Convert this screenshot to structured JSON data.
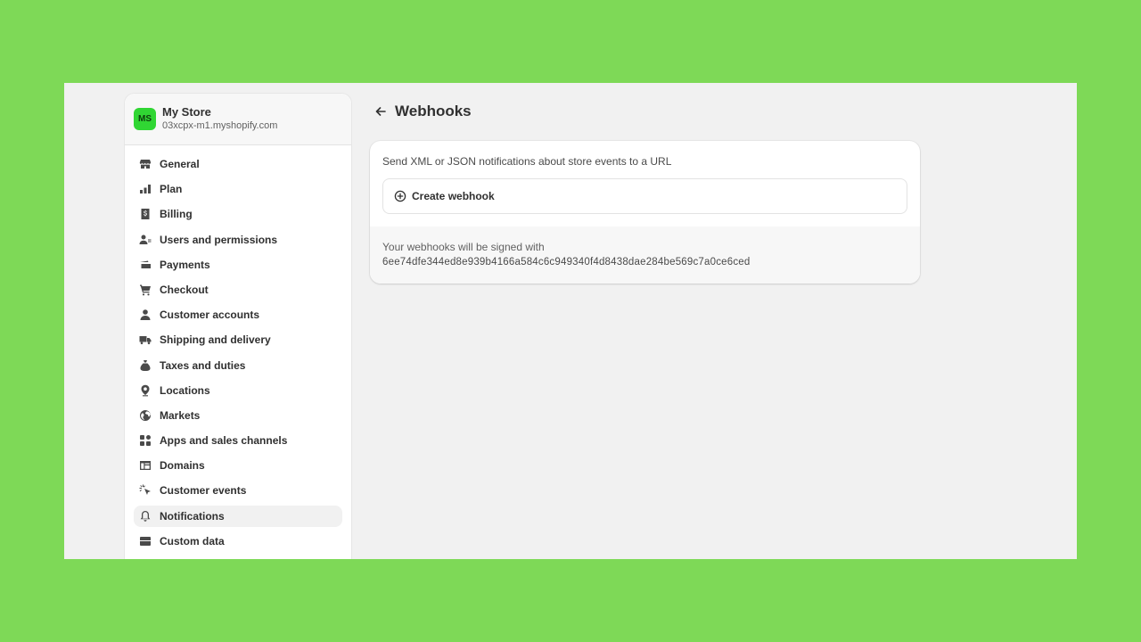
{
  "store": {
    "initials": "MS",
    "name": "My Store",
    "url": "03xcpx-m1.myshopify.com",
    "avatar_color": "#30d633"
  },
  "sidebar": {
    "items": [
      {
        "label": "General",
        "icon": "store-icon",
        "active": false
      },
      {
        "label": "Plan",
        "icon": "plan-icon",
        "active": false
      },
      {
        "label": "Billing",
        "icon": "billing-icon",
        "active": false
      },
      {
        "label": "Users and permissions",
        "icon": "users-icon",
        "active": false
      },
      {
        "label": "Payments",
        "icon": "payments-icon",
        "active": false
      },
      {
        "label": "Checkout",
        "icon": "cart-icon",
        "active": false
      },
      {
        "label": "Customer accounts",
        "icon": "person-icon",
        "active": false
      },
      {
        "label": "Shipping and delivery",
        "icon": "truck-icon",
        "active": false
      },
      {
        "label": "Taxes and duties",
        "icon": "tax-icon",
        "active": false
      },
      {
        "label": "Locations",
        "icon": "location-pin-icon",
        "active": false
      },
      {
        "label": "Markets",
        "icon": "globe-icon",
        "active": false
      },
      {
        "label": "Apps and sales channels",
        "icon": "apps-icon",
        "active": false
      },
      {
        "label": "Domains",
        "icon": "domains-icon",
        "active": false
      },
      {
        "label": "Customer events",
        "icon": "cursor-click-icon",
        "active": false
      },
      {
        "label": "Notifications",
        "icon": "bell-icon",
        "active": true
      },
      {
        "label": "Custom data",
        "icon": "custom-data-icon",
        "active": false
      }
    ]
  },
  "main": {
    "title": "Webhooks",
    "description": "Send XML or JSON notifications about store events to a URL",
    "create_button_label": "Create webhook",
    "signed_label": "Your webhooks will be signed with",
    "signing_key": "6ee74dfe344ed8e939b4166a584c6c949340f4d8438dae284be569c7a0ce6ced"
  },
  "colors": {
    "background": "#7ed957",
    "frame": "#f1f1f1",
    "card": "#ffffff",
    "text": "#303030"
  }
}
